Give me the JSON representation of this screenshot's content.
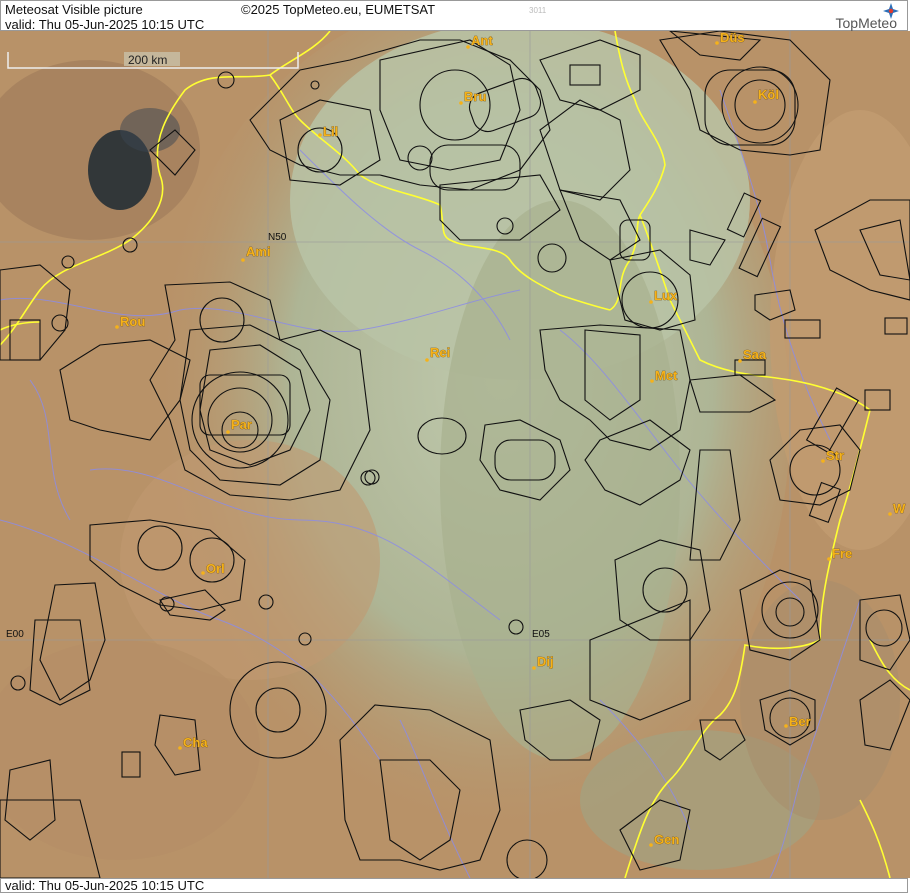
{
  "header": {
    "title": "Meteosat Visible picture",
    "valid": "valid:  Thu  05-Jun-2025  10:15 UTC",
    "copyright": "©2025 TopMeteo.eu, EUMETSAT",
    "code": "3011",
    "logo": "TopMeteo"
  },
  "footer": {
    "valid": "valid:  Thu  05-Jun-2025  10:15 UTC"
  },
  "scale": {
    "label": "200 km"
  },
  "grid_labels": {
    "n50": "N50",
    "e00": "E00",
    "e05": "E05"
  },
  "cities": [
    {
      "id": "ant",
      "label": "Ant"
    },
    {
      "id": "dus",
      "label": "Düs"
    },
    {
      "id": "bru",
      "label": "Bru"
    },
    {
      "id": "kol",
      "label": "Köl"
    },
    {
      "id": "lil",
      "label": "Lil"
    },
    {
      "id": "ami",
      "label": "Ami"
    },
    {
      "id": "lux",
      "label": "Lux"
    },
    {
      "id": "rou",
      "label": "Rou"
    },
    {
      "id": "rei",
      "label": "Rei"
    },
    {
      "id": "saa",
      "label": "Saa"
    },
    {
      "id": "met",
      "label": "Met"
    },
    {
      "id": "par",
      "label": "Par"
    },
    {
      "id": "str",
      "label": "Str"
    },
    {
      "id": "w",
      "label": "W"
    },
    {
      "id": "fre",
      "label": "Fre"
    },
    {
      "id": "orl",
      "label": "Orl"
    },
    {
      "id": "dij",
      "label": "Dij"
    },
    {
      "id": "ber",
      "label": "Ber"
    },
    {
      "id": "cha",
      "label": "Cha"
    },
    {
      "id": "gen",
      "label": "Gen"
    }
  ],
  "colors": {
    "terrain": "#b89268",
    "cloud_haze": "#b8c3a8",
    "border": "#ffff33",
    "rivers": "#8c8ce6",
    "airspace": "#111111",
    "city": "#f5b21a"
  }
}
